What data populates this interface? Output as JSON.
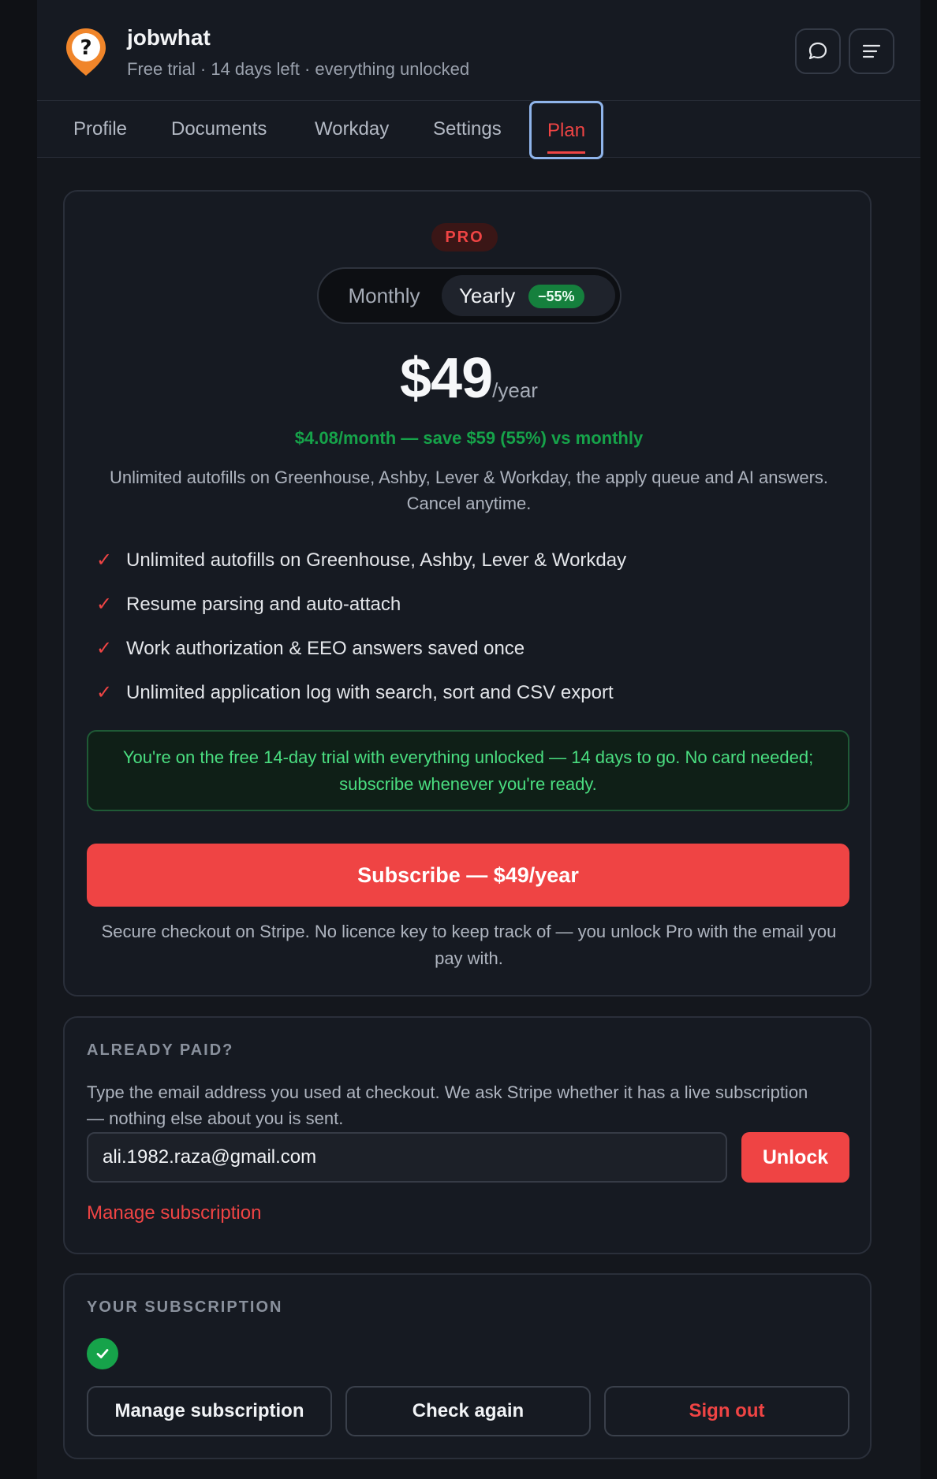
{
  "header": {
    "app_name": "jobwhat",
    "subtitle": "Free trial · 14 days left · everything unlocked"
  },
  "tabs": [
    {
      "label": "Profile"
    },
    {
      "label": "Documents"
    },
    {
      "label": "Workday"
    },
    {
      "label": "Settings"
    },
    {
      "label": "Plan",
      "active": true
    }
  ],
  "plan_card": {
    "badge": "PRO",
    "toggle": {
      "monthly_label": "Monthly",
      "yearly_label": "Yearly",
      "yearly_discount": "−55%",
      "selected": "Yearly"
    },
    "price": "$49",
    "period": "/year",
    "savings": "$4.08/month — save $59 (55%) vs monthly",
    "description": "Unlimited autofills on Greenhouse, Ashby, Lever & Workday, the apply queue and AI answers. Cancel anytime.",
    "features": [
      "Unlimited autofills on Greenhouse, Ashby, Lever & Workday",
      "Resume parsing and auto-attach",
      "Work authorization & EEO answers saved once",
      "Unlimited application log with search, sort and CSV export"
    ],
    "trial_notice": "You're on the free 14-day trial with everything unlocked — 14 days to go. No card needed; subscribe whenever you're ready.",
    "subscribe_label": "Subscribe — $49/year",
    "checkout_note": "Secure checkout on Stripe. No licence key to keep track of — you unlock Pro with the email you pay with."
  },
  "already_paid": {
    "title": "ALREADY PAID?",
    "description": "Type the email address you used at checkout. We ask Stripe whether it has a live subscription — nothing else about you is sent.",
    "email_value": "ali.1982.raza@gmail.com",
    "unlock_label": "Unlock",
    "manage_link": "Manage subscription"
  },
  "your_subscription": {
    "title": "YOUR SUBSCRIPTION",
    "manage_label": "Manage subscription",
    "check_again_label": "Check again",
    "sign_out_label": "Sign out"
  },
  "colors": {
    "accent": "#ef4444",
    "success": "#16a34a",
    "background": "#14171d"
  },
  "icons": {
    "logo": "question-pin-logo",
    "chat": "chat-bubble-icon",
    "menu": "menu-lines-icon",
    "feature_check": "checkmark-icon",
    "status": "check-circle-icon"
  }
}
